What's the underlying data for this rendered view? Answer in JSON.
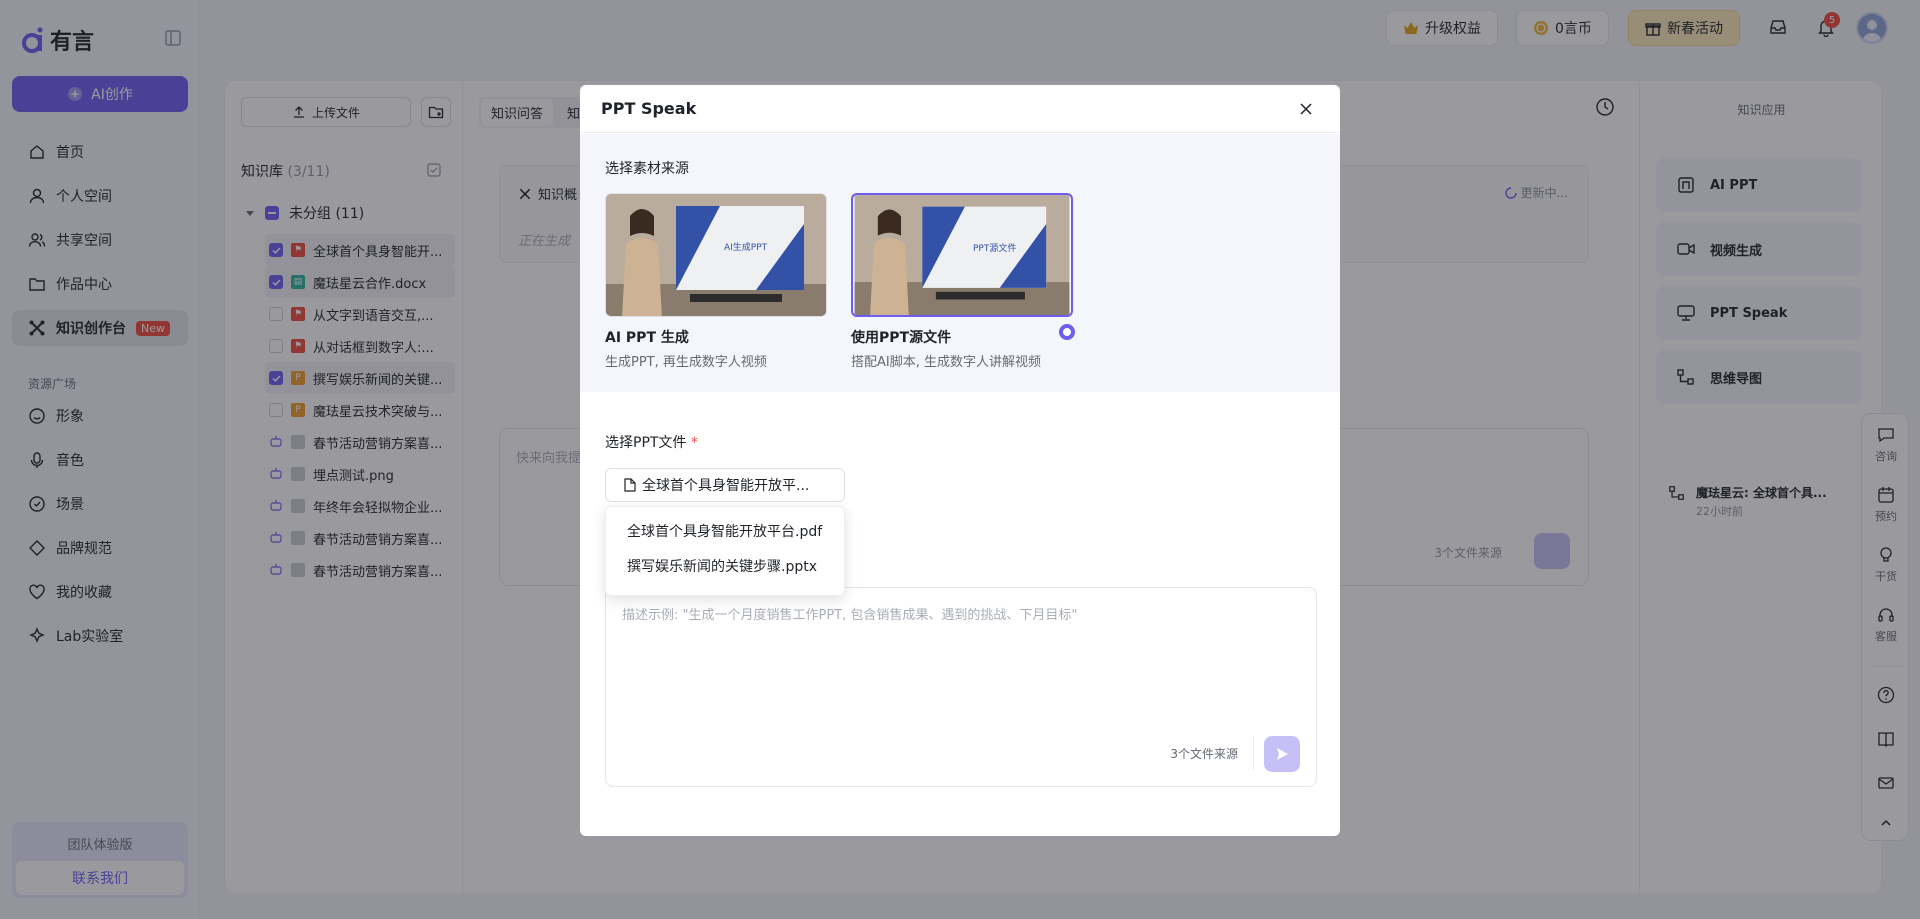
{
  "brand": {
    "name": "有言"
  },
  "sidebar": {
    "ai_create_label": "AI创作",
    "nav": [
      {
        "label": "首页",
        "icon": "home-icon"
      },
      {
        "label": "个人空间",
        "icon": "user-icon"
      },
      {
        "label": "共享空间",
        "icon": "team-icon"
      },
      {
        "label": "作品中心",
        "icon": "folder-icon"
      },
      {
        "label": "知识创作台",
        "icon": "knowledge-icon",
        "badge": "New",
        "active": true
      }
    ],
    "section_label": "资源广场",
    "resources": [
      {
        "label": "形象",
        "icon": "face-icon"
      },
      {
        "label": "音色",
        "icon": "microphone-icon"
      },
      {
        "label": "场景",
        "icon": "scene-icon"
      },
      {
        "label": "品牌规范",
        "icon": "brand-icon"
      },
      {
        "label": "我的收藏",
        "icon": "heart-icon"
      },
      {
        "label": "Lab实验室",
        "icon": "lab-icon"
      }
    ],
    "team_title": "团队体验版",
    "contact_label": "联系我们"
  },
  "topbar": {
    "upgrade_label": "升级权益",
    "coins_label": "0言币",
    "newyear_label": "新春活动",
    "notification_count": "5"
  },
  "knowledge_base": {
    "upload_label": "上传文件",
    "title": "知识库",
    "count": "(3/11)",
    "group_label": "未分组 (11)",
    "files": [
      {
        "name": "全球首个具身智能开...",
        "type": "pdf",
        "checked": true
      },
      {
        "name": "魔珐星云合作.docx",
        "type": "doc",
        "checked": true
      },
      {
        "name": "从文字到语音交互,...",
        "type": "pdf",
        "checked": false
      },
      {
        "name": "从对话框到数字人:...",
        "type": "pdf",
        "checked": false
      },
      {
        "name": "撰写娱乐新闻的关键...",
        "type": "ppt",
        "checked": true
      },
      {
        "name": "魔珐星云技术突破与...",
        "type": "ppt",
        "checked": false
      },
      {
        "name": "春节活动营销方案喜...",
        "type": "gen",
        "checked": false
      },
      {
        "name": "埋点测试.png",
        "type": "gen",
        "checked": false
      },
      {
        "name": "年终年会轻拟物企业...",
        "type": "gen",
        "checked": false
      },
      {
        "name": "春节活动营销方案喜...",
        "type": "gen",
        "checked": false
      },
      {
        "name": "春节活动营销方案喜...",
        "type": "gen",
        "checked": false
      }
    ]
  },
  "center": {
    "tabs": [
      "知识问答",
      "知"
    ],
    "card_title": "知识概",
    "card_status": "正在生成",
    "updating_label": "更新中...",
    "input_placeholder": "快来向我提",
    "source_count": "3个文件来源"
  },
  "apps": {
    "title": "知识应用",
    "items": [
      {
        "label": "AI PPT",
        "icon": "ai-ppt-icon"
      },
      {
        "label": "视频生成",
        "icon": "video-icon"
      },
      {
        "label": "PPT Speak",
        "icon": "presentation-icon"
      },
      {
        "label": "思维导图",
        "icon": "mindmap-icon"
      }
    ],
    "history_title": "魔珐星云: 全球首个具...",
    "history_time": "22小时前"
  },
  "float_bar": [
    {
      "label": "咨询",
      "icon": "chat-icon"
    },
    {
      "label": "预约",
      "icon": "calendar-icon"
    },
    {
      "label": "干货",
      "icon": "bulb-icon"
    },
    {
      "label": "客服",
      "icon": "headset-icon"
    }
  ],
  "modal": {
    "title": "PPT Speak",
    "source_label": "选择素材来源",
    "options": [
      {
        "title": "AI PPT 生成",
        "desc": "生成PPT, 再生成数字人视频",
        "thumb_text": "AI生成PPT",
        "selected": false
      },
      {
        "title": "使用PPT源文件",
        "desc": "搭配AI脚本, 生成数字人讲解视频",
        "thumb_text": "PPT源文件",
        "selected": true
      }
    ],
    "file_label": "选择PPT文件",
    "required_mark": "*",
    "selected_file": "全球首个具身智能开放平...",
    "dropdown_options": [
      "全球首个具身智能开放平台.pdf",
      "撰写娱乐新闻的关键步骤.pptx"
    ],
    "prompt_placeholder": "描述示例: \"生成一个月度销售工作PPT, 包含销售成果、遇到的挑战、下月目标\"",
    "source_count": "3个文件来源"
  },
  "colors": {
    "accent": "#6e5cf0",
    "overlay": "rgba(30,32,40,0.45)",
    "danger": "#f04a3e"
  }
}
